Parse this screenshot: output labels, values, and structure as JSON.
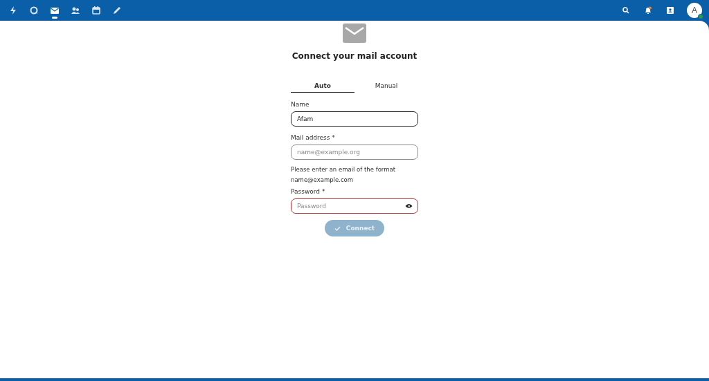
{
  "top_bar": {
    "apps": [
      {
        "kind": "dashboard",
        "selected": false
      },
      {
        "kind": "talk",
        "selected": false
      },
      {
        "kind": "mail",
        "selected": true
      },
      {
        "kind": "contacts",
        "selected": false
      },
      {
        "kind": "calendar",
        "selected": false
      },
      {
        "kind": "notes",
        "selected": false
      }
    ],
    "avatar": {
      "initial": "A",
      "online": true
    },
    "notifications": {
      "unread": true
    }
  },
  "form": {
    "title": "Connect your mail account",
    "tabs": [
      {
        "label": "Auto",
        "selected": true
      },
      {
        "label": "Manual",
        "selected": false
      }
    ],
    "fields": [
      {
        "label": "Name",
        "value": "Afam",
        "focused": true,
        "invalid": false
      },
      {
        "label": "Mail address *",
        "placeholder": "name@example.org",
        "focused": false,
        "invalid": false,
        "hint": "Please enter an email of the format name@example.com"
      },
      {
        "label": "Password *",
        "placeholder": "Password",
        "focused": false,
        "invalid": true,
        "password": true
      }
    ],
    "submit": {
      "label": "Connect",
      "disabled": true
    }
  }
}
